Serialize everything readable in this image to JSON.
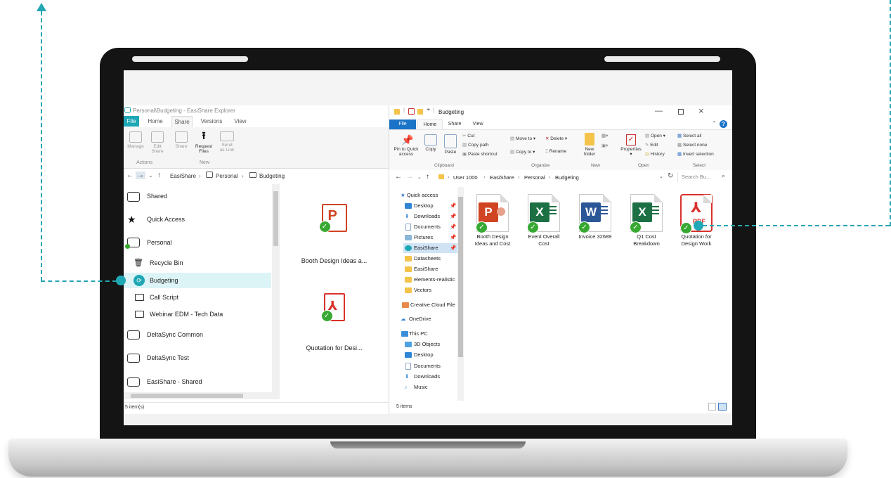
{
  "colors": {
    "accent": "#1ea7b5",
    "selection": "#ddf4f7",
    "ppt": "#d04423",
    "xls": "#1d7044",
    "doc": "#2b5797",
    "pdf": "#d9312b",
    "check": "#37a832"
  },
  "left_window": {
    "title": "Personal\\Budgeting - EasiShare Explorer",
    "tabs": [
      "File",
      "Home",
      "Share",
      "Versions",
      "View"
    ],
    "ribbon": {
      "manage": "Manage",
      "edit_share": [
        "Edit",
        "Share"
      ],
      "share": "Share",
      "request_files": [
        "Request",
        "Files"
      ],
      "send_as_link": [
        "Send",
        "as Link"
      ],
      "group_actions": "Actions",
      "group_new": "New"
    },
    "address": {
      "root": "EasiShare",
      "sep": "›",
      "level1": "Personal",
      "level2": "Budgeting"
    },
    "tree": [
      {
        "label": "Shared",
        "icon": "shared-folder-icon"
      },
      {
        "label": "Quick Access",
        "icon": "star-icon"
      },
      {
        "label": "Personal",
        "icon": "personal-drive-icon"
      },
      {
        "label": "Recycle Bin",
        "icon": "trash-icon"
      },
      {
        "label": "Budgeting",
        "icon": "synced-folder-icon"
      },
      {
        "label": "Call Script",
        "icon": "folder-icon"
      },
      {
        "label": "Webinar EDM - Tech Data",
        "icon": "folder-icon"
      },
      {
        "label": "DeltaSync Common",
        "icon": "drive-icon"
      },
      {
        "label": "DeltaSync Test",
        "icon": "drive-icon"
      },
      {
        "label": "EasiShare - Shared",
        "icon": "drive-icon"
      }
    ],
    "files": [
      {
        "name": "Booth Design Ideas a...",
        "icon": "powerpoint-icon"
      },
      {
        "name": "Quotation for Desi...",
        "icon": "pdf-icon"
      }
    ],
    "status": "5 item(s)"
  },
  "right_window": {
    "title": "Budgeting",
    "tabs": [
      "File",
      "Home",
      "Share",
      "View"
    ],
    "ribbon": {
      "pin": [
        "Pin to Quick",
        "access"
      ],
      "copy": "Copy",
      "paste": "Paste",
      "cut": "Cut",
      "copy_path": "Copy path",
      "paste_shortcut": "Paste shortcut",
      "move_to": "Move to ▾",
      "delete": "Delete ▾",
      "copy_to": "Copy to ▾",
      "rename": "Rename",
      "new_folder": [
        "New",
        "folder"
      ],
      "properties": "Properties",
      "open": "Open ▾",
      "edit": "Edit",
      "history": "History",
      "select_all": "Select all",
      "select_none": "Select none",
      "invert_selection": "Invert selection",
      "groups": [
        "Clipboard",
        "Organize",
        "New",
        "Open",
        "Select"
      ]
    },
    "address": {
      "path": [
        "User 1000",
        "EasiShare",
        "Personal",
        "Budgeting"
      ],
      "search_placeholder": "Search Bu..."
    },
    "nav": [
      {
        "label": "Quick access",
        "pinned": false
      },
      {
        "label": "Desktop",
        "pinned": true
      },
      {
        "label": "Downloads",
        "pinned": true
      },
      {
        "label": "Documents",
        "pinned": true
      },
      {
        "label": "Pictures",
        "pinned": true
      },
      {
        "label": "EasiShare",
        "pinned": true
      },
      {
        "label": "Datasheets",
        "pinned": false
      },
      {
        "label": "EasiShare",
        "pinned": false
      },
      {
        "label": "elements-realistic",
        "pinned": false
      },
      {
        "label": "Vectors",
        "pinned": false
      },
      {
        "label": "Creative Cloud File",
        "pinned": false
      },
      {
        "label": "OneDrive",
        "pinned": false
      },
      {
        "label": "This PC",
        "pinned": false
      },
      {
        "label": "3D Objects",
        "pinned": false
      },
      {
        "label": "Desktop",
        "pinned": false
      },
      {
        "label": "Documents",
        "pinned": false
      },
      {
        "label": "Downloads",
        "pinned": false
      },
      {
        "label": "Music",
        "pinned": false
      }
    ],
    "files": [
      {
        "name": [
          "Booth Design",
          "Ideas and Cost"
        ],
        "icon": "powerpoint-icon",
        "letter": "P"
      },
      {
        "name": [
          "Event Overall",
          "Cost"
        ],
        "icon": "excel-icon",
        "letter": "X"
      },
      {
        "name": [
          "Invoice 32689"
        ],
        "icon": "word-icon",
        "letter": "W"
      },
      {
        "name": [
          "Q1 Cost",
          "Breakdown"
        ],
        "icon": "excel-icon",
        "letter": "X"
      },
      {
        "name": [
          "Quotation for",
          "Design Work"
        ],
        "icon": "pdf-icon",
        "letter": "PDF"
      }
    ],
    "status": "5 items"
  }
}
